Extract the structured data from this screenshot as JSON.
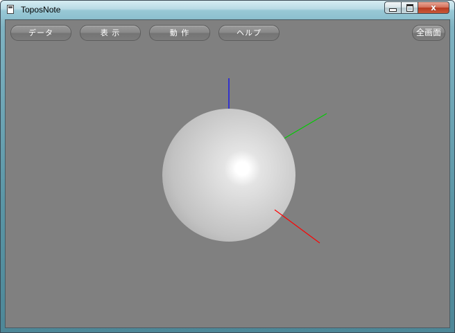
{
  "window": {
    "title": "ToposNote",
    "caption_buttons": {
      "minimize_icon": "minimize-icon",
      "maximize_icon": "maximize-icon",
      "close_label": "x"
    }
  },
  "toolbar": {
    "data_label": "データ",
    "view_label": "表 示",
    "action_label": "動 作",
    "help_label": "ヘルプ",
    "fullscreen_label": "全画面"
  },
  "scene": {
    "background_color": "#808080",
    "sphere_color": "#d8d8d8",
    "axes": [
      {
        "name": "z-axis",
        "color": "#0000ff"
      },
      {
        "name": "y-axis",
        "color": "#00cc00"
      },
      {
        "name": "x-axis",
        "color": "#ff0000"
      }
    ]
  }
}
